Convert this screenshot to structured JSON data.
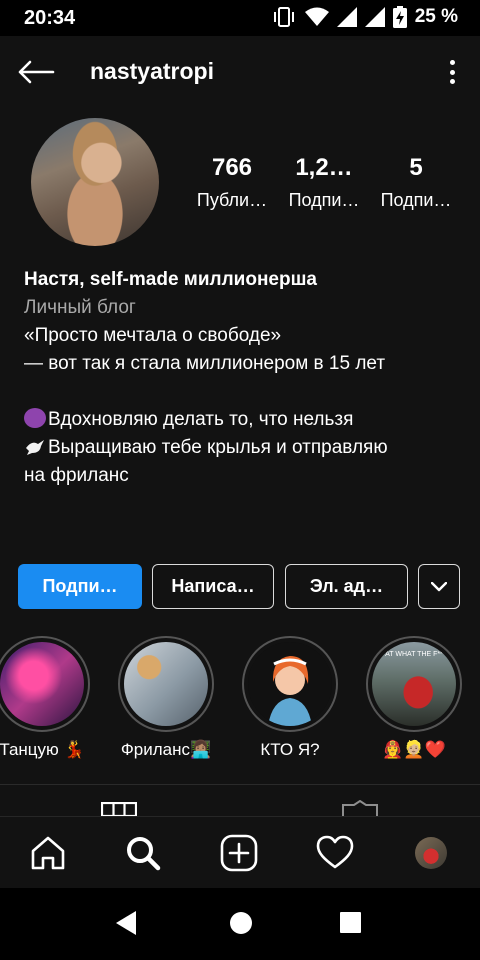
{
  "status": {
    "time": "20:34",
    "battery_text": "25 %",
    "icons": [
      "vibrate-icon",
      "wifi-icon",
      "signal-icon",
      "signal-icon",
      "battery-charging-icon"
    ]
  },
  "header": {
    "username": "nastyatropi",
    "icons": [
      "back-arrow-icon",
      "more-vertical-icon"
    ]
  },
  "stats": [
    {
      "value": "766",
      "label": "Публи…"
    },
    {
      "value": "1,2…",
      "label": "Подпи…"
    },
    {
      "value": "5",
      "label": "Подпи…"
    }
  ],
  "bio": {
    "name": "Настя, self-made миллионерша",
    "category": "Личный блог",
    "line1": "«Просто мечтала о свободе»",
    "line2": "— вот так я стала миллионером в 15 лет",
    "line3": "Вдохновляю делать то, что нельзя",
    "line4a": "Выращиваю тебе крылья и отправляю",
    "line4b": "на фриланс"
  },
  "actions": {
    "follow": "Подпи…",
    "message": "Написа…",
    "email": "Эл. ад…"
  },
  "highlights": [
    {
      "label": "Танцую 💃"
    },
    {
      "label": "Фриланс👩🏽‍💻"
    },
    {
      "label": "КТО Я?"
    },
    {
      "label": "👩‍🚒👱🏼❤️"
    }
  ],
  "highlight_4_caption": "AT WHAT THE F**",
  "colors": {
    "accent": "#1a8cf2",
    "background": "#121212"
  }
}
